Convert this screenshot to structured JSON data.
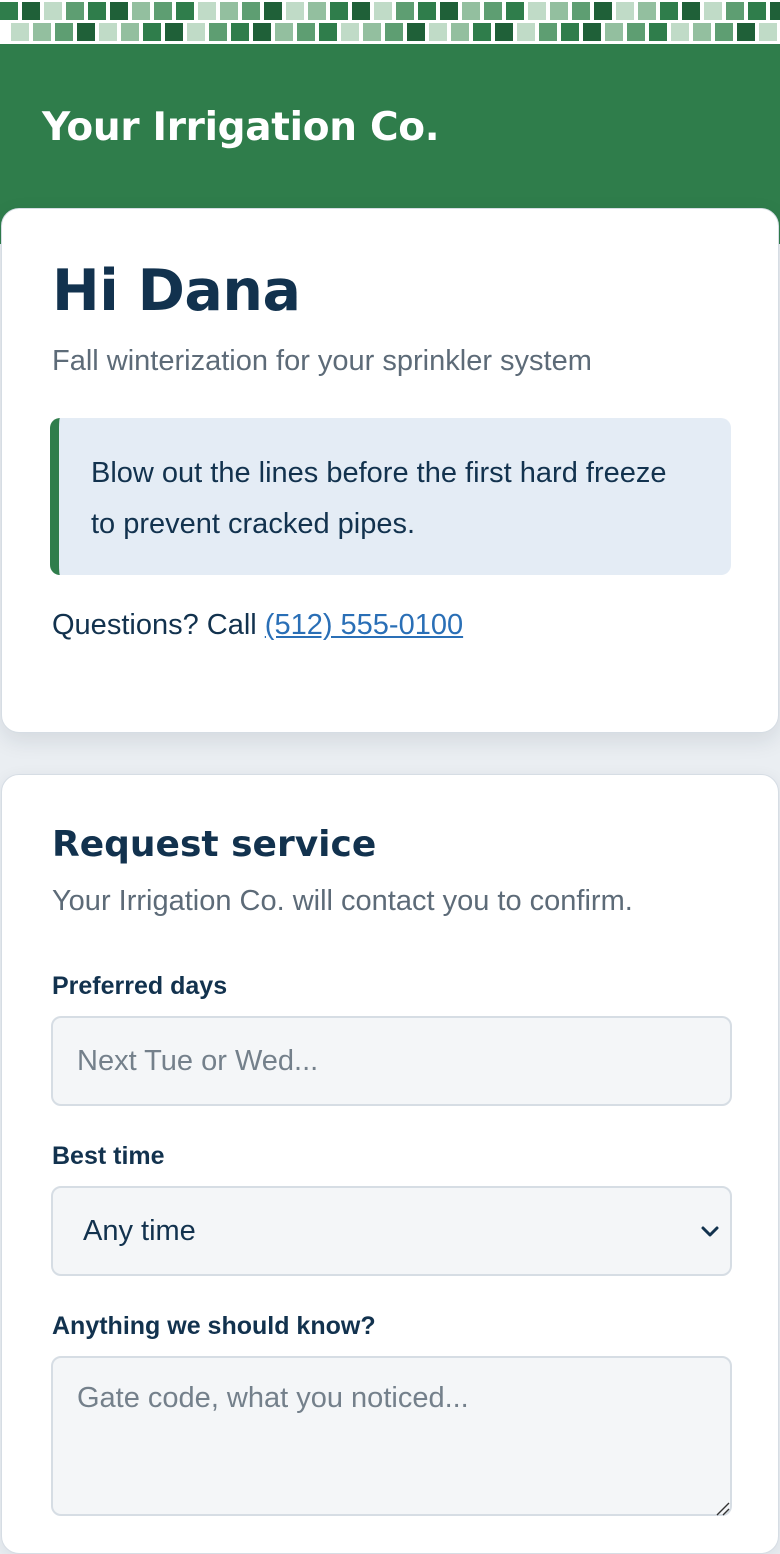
{
  "brand": {
    "name": "Your Irrigation Co.",
    "header_color": "#2f7d4b",
    "mosaic_colors": [
      "#2f7d4b",
      "#5e9e72",
      "#93bf9f",
      "#c0dbc7",
      "#1f6038"
    ]
  },
  "greeting_card": {
    "greeting": "Hi Dana",
    "subtitle": "Fall winterization for your sprinkler system",
    "tip": "Blow out the lines before the first hard freeze to prevent cracked pipes.",
    "questions_prefix": "Questions? Call ",
    "phone": "(512) 555-0100"
  },
  "request_form": {
    "title": "Request service",
    "subtitle": "Your Irrigation Co. will contact you to confirm.",
    "preferred_days": {
      "label": "Preferred days",
      "placeholder": "Next Tue or Wed...",
      "value": ""
    },
    "best_time": {
      "label": "Best time",
      "selected": "Any time",
      "icon": "chevron-down-icon"
    },
    "notes": {
      "label": "Anything we should know?",
      "placeholder": "Gate code, what you noticed...",
      "value": ""
    }
  }
}
